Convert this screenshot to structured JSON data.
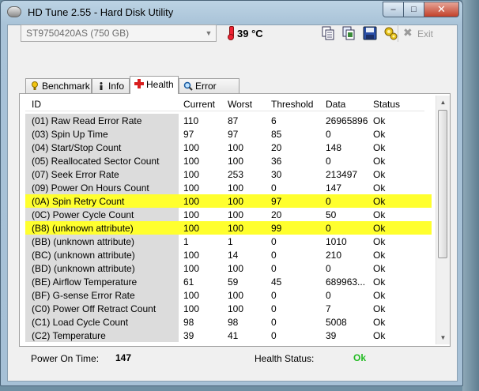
{
  "window": {
    "title": "HD Tune 2.55 - Hard Disk Utility"
  },
  "toolbar": {
    "drive": "ST9750420AS (750 GB)",
    "temperature": "39 °C",
    "exit_label": "Exit"
  },
  "tabs": [
    {
      "label": "Benchmark",
      "active": false
    },
    {
      "label": "Info",
      "active": false
    },
    {
      "label": "Health",
      "active": true
    },
    {
      "label": "Error Scan",
      "active": false
    }
  ],
  "table": {
    "headers": [
      "ID",
      "Current",
      "Worst",
      "Threshold",
      "Data",
      "Status"
    ],
    "rows": [
      {
        "id": "(01) Raw Read Error Rate",
        "current": "110",
        "worst": "87",
        "threshold": "6",
        "data": "26965896",
        "status": "Ok",
        "highlight": false
      },
      {
        "id": "(03) Spin Up Time",
        "current": "97",
        "worst": "97",
        "threshold": "85",
        "data": "0",
        "status": "Ok",
        "highlight": false
      },
      {
        "id": "(04) Start/Stop Count",
        "current": "100",
        "worst": "100",
        "threshold": "20",
        "data": "148",
        "status": "Ok",
        "highlight": false
      },
      {
        "id": "(05) Reallocated Sector Count",
        "current": "100",
        "worst": "100",
        "threshold": "36",
        "data": "0",
        "status": "Ok",
        "highlight": false
      },
      {
        "id": "(07) Seek Error Rate",
        "current": "100",
        "worst": "253",
        "threshold": "30",
        "data": "213497",
        "status": "Ok",
        "highlight": false
      },
      {
        "id": "(09) Power On Hours Count",
        "current": "100",
        "worst": "100",
        "threshold": "0",
        "data": "147",
        "status": "Ok",
        "highlight": false
      },
      {
        "id": "(0A) Spin Retry Count",
        "current": "100",
        "worst": "100",
        "threshold": "97",
        "data": "0",
        "status": "Ok",
        "highlight": true
      },
      {
        "id": "(0C) Power Cycle Count",
        "current": "100",
        "worst": "100",
        "threshold": "20",
        "data": "50",
        "status": "Ok",
        "highlight": false
      },
      {
        "id": "(B8) (unknown attribute)",
        "current": "100",
        "worst": "100",
        "threshold": "99",
        "data": "0",
        "status": "Ok",
        "highlight": true
      },
      {
        "id": "(BB) (unknown attribute)",
        "current": "1",
        "worst": "1",
        "threshold": "0",
        "data": "1010",
        "status": "Ok",
        "highlight": false
      },
      {
        "id": "(BC) (unknown attribute)",
        "current": "100",
        "worst": "14",
        "threshold": "0",
        "data": "210",
        "status": "Ok",
        "highlight": false
      },
      {
        "id": "(BD) (unknown attribute)",
        "current": "100",
        "worst": "100",
        "threshold": "0",
        "data": "0",
        "status": "Ok",
        "highlight": false
      },
      {
        "id": "(BE) Airflow Temperature",
        "current": "61",
        "worst": "59",
        "threshold": "45",
        "data": "689963...",
        "status": "Ok",
        "highlight": false
      },
      {
        "id": "(BF) G-sense Error Rate",
        "current": "100",
        "worst": "100",
        "threshold": "0",
        "data": "0",
        "status": "Ok",
        "highlight": false
      },
      {
        "id": "(C0) Power Off Retract Count",
        "current": "100",
        "worst": "100",
        "threshold": "0",
        "data": "7",
        "status": "Ok",
        "highlight": false
      },
      {
        "id": "(C1) Load Cycle Count",
        "current": "98",
        "worst": "98",
        "threshold": "0",
        "data": "5008",
        "status": "Ok",
        "highlight": false
      },
      {
        "id": "(C2) Temperature",
        "current": "39",
        "worst": "41",
        "threshold": "0",
        "data": "39",
        "status": "Ok",
        "highlight": false
      }
    ]
  },
  "footer": {
    "power_on_label": "Power On Time:",
    "power_on_value": "147",
    "health_label": "Health Status:",
    "health_value": "Ok"
  },
  "colors": {
    "highlight": "#ffff2e",
    "health_ok": "#22bb22",
    "id_column": "#dcdcdc"
  }
}
